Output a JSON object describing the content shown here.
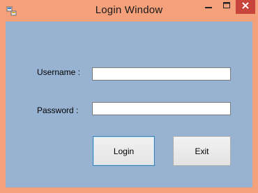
{
  "window": {
    "title": "Login Window"
  },
  "titlebar": {
    "icons": [
      "app-icon",
      "minimize-icon",
      "maximize-icon",
      "close-icon"
    ]
  },
  "form": {
    "username_label": "Username :",
    "username_value": "",
    "password_label": "Password :",
    "password_value": "",
    "login_label": "Login",
    "exit_label": "Exit"
  },
  "colors": {
    "window_frame": "#f4a07a",
    "client_background": "#98b2d1",
    "close_button": "#c7453a",
    "focused_button_border": "#3c7fb1"
  }
}
